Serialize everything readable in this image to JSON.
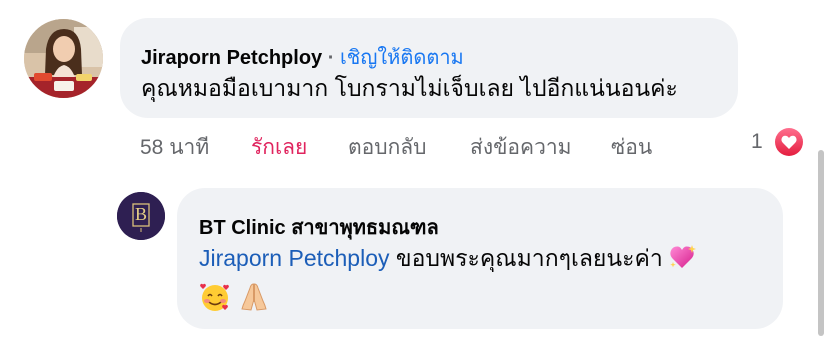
{
  "comment": {
    "author": "Jiraporn Petchploy",
    "separator": "·",
    "follow_label": "เชิญให้ติดตาม",
    "text": "คุณหมอมือเบามาก โบกรามไม่เจ็บเลย ไปอีกแน่นอนค่ะ",
    "avatar_icon": "user-photo-avatar",
    "actions": {
      "time": "58 นาที",
      "love": "รักเลย",
      "reply": "ตอบกลับ",
      "message": "ส่งข้อความ",
      "hide": "ซ่อน"
    },
    "reaction_count": "1",
    "reaction_icon": "heart-icon"
  },
  "reply": {
    "author": "BT Clinic สาขาพุทธมณฑล",
    "avatar_text": "B",
    "avatar_icon": "bt-clinic-logo",
    "mention": "Jiraporn Petchploy",
    "text": "ขอบพระคุณมากๆเลยนะค่า",
    "emoji_icons": [
      "sparkling-heart-icon",
      "smiling-face-with-hearts-icon",
      "folded-hands-icon"
    ]
  },
  "colors": {
    "bubble": "#f0f2f5",
    "love": "#e0245e",
    "link": "#1877f2",
    "mention": "#1c5eb8",
    "secondary_text": "#65676b"
  }
}
